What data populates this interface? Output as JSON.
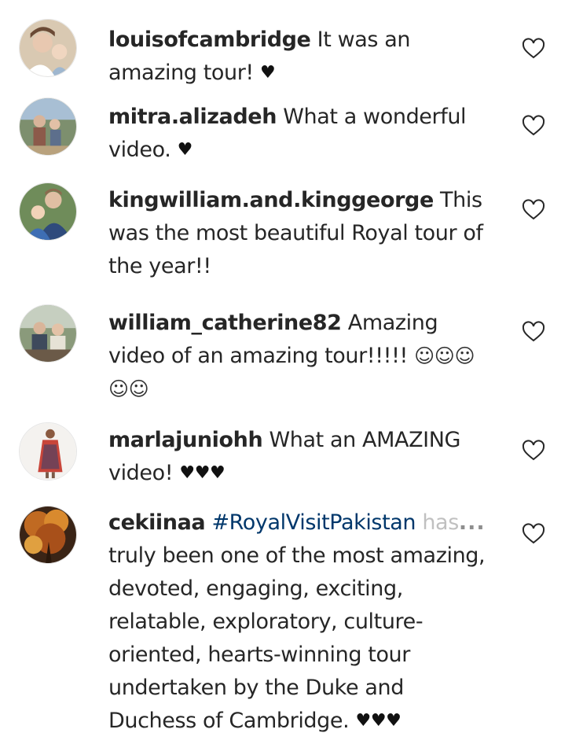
{
  "comments": [
    {
      "username": "louisofcambridge",
      "text": " It was an amazing tour! ",
      "suffix_icons": [
        "black-heart"
      ],
      "avatar": "avatar-woman-child"
    },
    {
      "username": "mitra.alizadeh",
      "text": " What a wonderful video. ",
      "suffix_icons": [
        "black-heart"
      ],
      "avatar": "avatar-family-outdoor"
    },
    {
      "username": "kingwilliam.and.kinggeorge",
      "text": " This was the most beautiful Royal tour of the year!!",
      "suffix_icons": [],
      "avatar": "avatar-man-boy"
    },
    {
      "username": "william_catherine82",
      "text": " Amazing video of an amazing tour!!!!! ",
      "suffix_icons": [
        "smiley",
        "smiley",
        "smiley",
        "smiley",
        "smiley"
      ],
      "avatar": "avatar-couple-seated"
    },
    {
      "username": "marlajuniohh",
      "text": " What an AMAZING video! ",
      "suffix_icons": [
        "black-heart",
        "black-heart",
        "black-heart"
      ],
      "avatar": "avatar-woman-dress"
    },
    {
      "username": "cekiinaa",
      "hashtag": "#RoyalVisitPakistan",
      "faded_text": " has",
      "more": "...",
      "text": " truly been one of the most amazing, devoted, engaging, exciting, relatable, exploratory, culture-oriented, hearts-winning tour undertaken by the Duke and Duchess of Cambridge. ",
      "suffix_icons": [
        "black-heart",
        "black-heart",
        "black-heart"
      ],
      "avatar": "avatar-autumn-tree"
    }
  ],
  "icons": {
    "like": "heart-outline-icon",
    "black-heart": "♥",
    "smiley": "☺"
  },
  "colors": {
    "username": "#262626",
    "text": "#262626",
    "hashtag": "#00376b",
    "muted": "#8e8e8e"
  }
}
